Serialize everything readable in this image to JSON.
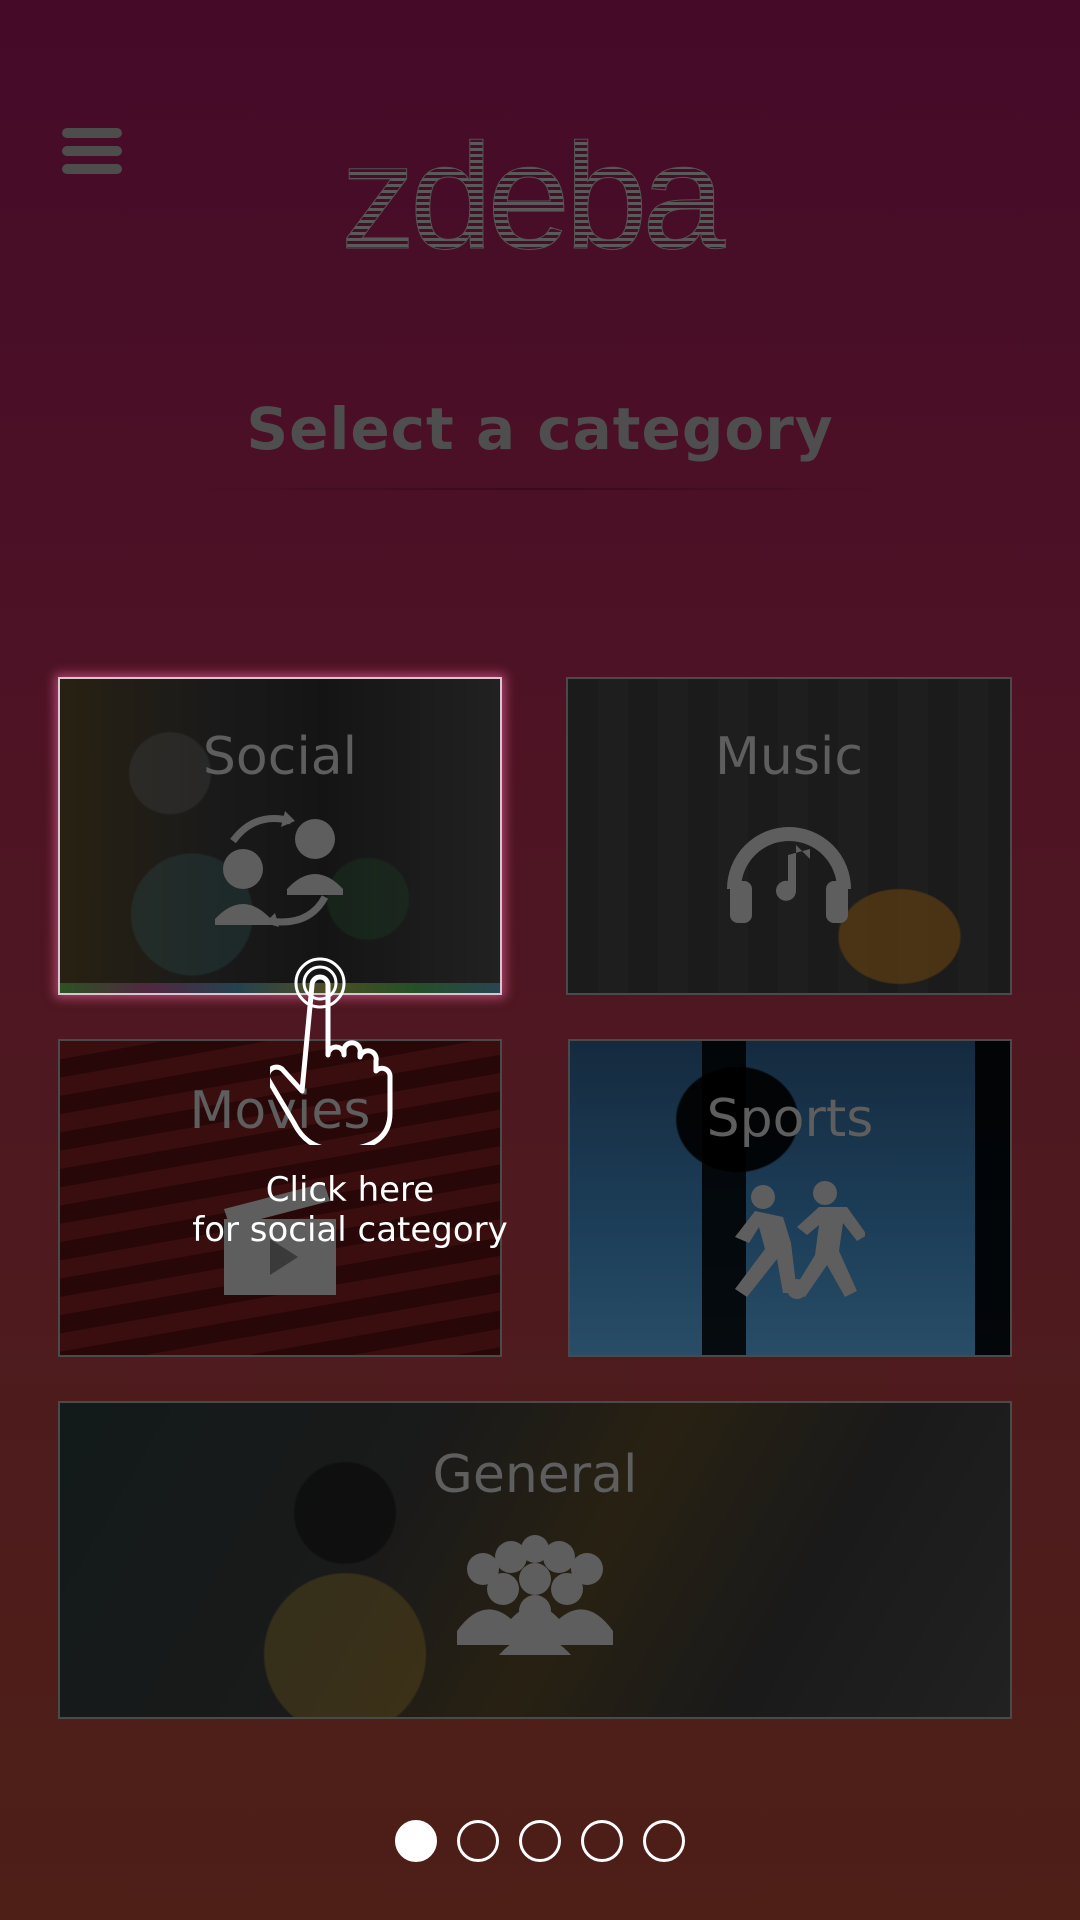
{
  "header": {
    "logo_text": "zdeba",
    "menu_icon": "hamburger-icon"
  },
  "page": {
    "title": "Select a category"
  },
  "categories": [
    {
      "label": "Social",
      "icon": "social-exchange-icon"
    },
    {
      "label": "Music",
      "icon": "headphones-note-icon"
    },
    {
      "label": "Movies",
      "icon": "clapperboard-play-icon"
    },
    {
      "label": "Sports",
      "icon": "players-soccer-icon"
    },
    {
      "label": "General",
      "icon": "group-people-icon"
    }
  ],
  "tutorial": {
    "line1": "Click here",
    "line2": "for social category",
    "icon": "tap-hand-icon"
  },
  "pager": {
    "count": 5,
    "active_index": 0
  },
  "colors": {
    "highlight_border": "#ff6eaa",
    "overlay_text": "#ffffff",
    "dim_text": "#5e5e5e"
  }
}
